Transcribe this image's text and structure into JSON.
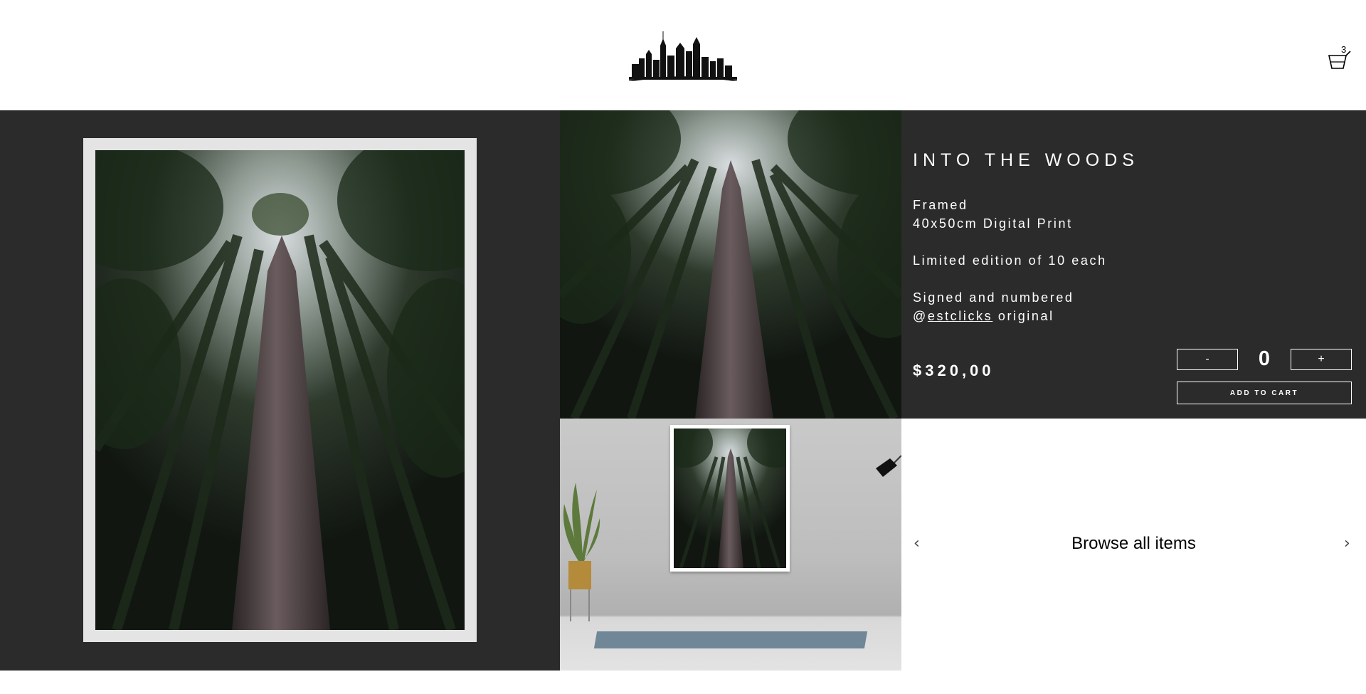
{
  "header": {
    "logo_icon": "city-skyline-logo-icon",
    "cart": {
      "count": "3",
      "icon": "shopping-basket-icon"
    }
  },
  "product": {
    "title": "INTO THE WOODS",
    "lines": [
      "Framed",
      "40x50cm Digital Print",
      "Limited edition of 10 each",
      "Signed and numbered"
    ],
    "handle_prefix": "@",
    "handle": "estclicks",
    "handle_suffix": " original",
    "price": "$320,00",
    "quantity": {
      "minus_label": "-",
      "value": "0",
      "plus_label": "+"
    },
    "add_to_cart_label": "ADD TO CART"
  },
  "browse": {
    "label": "Browse all items",
    "prev_icon": "chevron-left-icon",
    "next_icon": "chevron-right-icon",
    "prev_glyph": "‹",
    "next_glyph": "›"
  },
  "colors": {
    "band": "#2b2b2b",
    "frame": "#e4e4e4",
    "text_light": "#ffffff"
  }
}
